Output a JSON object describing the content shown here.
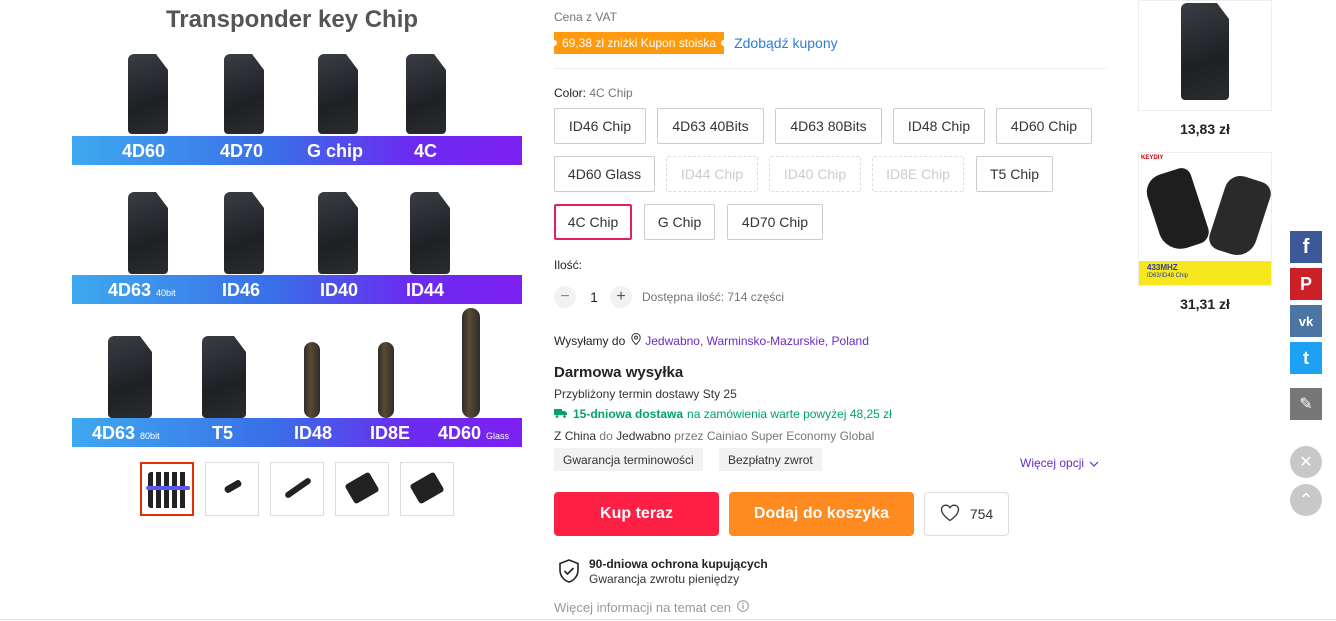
{
  "gallery": {
    "title": "Transponder key Chip",
    "row1": [
      "4D60",
      "4D70",
      "G chip",
      "4C"
    ],
    "row2": [
      {
        "label": "4D63",
        "suffix": "40bit"
      },
      {
        "label": "ID46",
        "suffix": ""
      },
      {
        "label": "ID40",
        "suffix": ""
      },
      {
        "label": "ID44",
        "suffix": ""
      }
    ],
    "row3": [
      {
        "label": "4D63",
        "suffix": "80bit"
      },
      {
        "label": "T5",
        "suffix": ""
      },
      {
        "label": "ID48",
        "suffix": ""
      },
      {
        "label": "ID8E",
        "suffix": ""
      },
      {
        "label": "4D60",
        "suffix": "Glass"
      }
    ]
  },
  "price_block": {
    "vat_label": "Cena z VAT",
    "coupon_badge": "69,38 zł zniżki Kupon stoiska",
    "coupon_link": "Zdobądź kupony"
  },
  "color": {
    "label": "Color:",
    "selected": "4C Chip",
    "options_row1": [
      "ID46 Chip",
      "4D63 40Bits",
      "4D63 80Bits",
      "ID48 Chip",
      "4D60 Chip"
    ],
    "options_row2": [
      "4D60 Glass",
      "ID44 Chip",
      "ID40 Chip",
      "ID8E Chip",
      "T5 Chip"
    ],
    "options_row3": [
      "4C Chip",
      "G Chip",
      "4D70 Chip"
    ]
  },
  "quantity": {
    "label": "Ilość:",
    "minus": "−",
    "value": "1",
    "plus": "+",
    "available": "Dostępna ilość: 714 części"
  },
  "shipping": {
    "ship_to_label": "Wysyłamy do",
    "destination": "Jedwabno, Warminsko-Mazurskie, Poland",
    "free_title": "Darmowa wysyłka",
    "eta_prefix": "Przybliżony termin dostawy",
    "eta_date": "Sty 25",
    "fast_title": "15-dniowa dostawa",
    "fast_suffix": "na zamówienia warte powyżej 48,25 zł",
    "route_from": "Z",
    "origin": "China",
    "route_to": "do",
    "dest_city": "Jedwabno",
    "route_via": "przez Cainiao Super Economy Global",
    "tags": [
      "Gwarancja terminowości",
      "Bezpłatny zwrot"
    ],
    "more_options": "Więcej opcji"
  },
  "actions": {
    "buy_now": "Kup teraz",
    "add_to_cart": "Dodaj do koszyka",
    "wishlist_count": "754"
  },
  "protection": {
    "title": "90-dniowa ochrona kupujących",
    "subtitle": "Gwarancja zwrotu pieniędzy",
    "more_info": "Więcej informacji na temat cen"
  },
  "recommendations": [
    {
      "price": "13,83 zł"
    },
    {
      "price": "31,31 zł",
      "brand": "KEYDIY",
      "banner": "433MHZ",
      "note": "ID63/ID48 Chip"
    }
  ],
  "share": {
    "facebook": "f",
    "pinterest": "P",
    "vk": "vk",
    "twitter": "t",
    "edit": "✎",
    "close": "✕",
    "top": "⌃"
  },
  "colors": {
    "buy_now": "#fe1f45",
    "add_to_cart": "#ff8a1f",
    "coupon": "#ff9a0f",
    "link_blue": "#2e7bd4",
    "fast_green": "#00a36b",
    "selected_border": "#e4205c",
    "facebook": "#3b5998",
    "pinterest": "#cb2027",
    "vk": "#4c75a3",
    "twitter": "#1da1f2",
    "edit": "#777777"
  }
}
